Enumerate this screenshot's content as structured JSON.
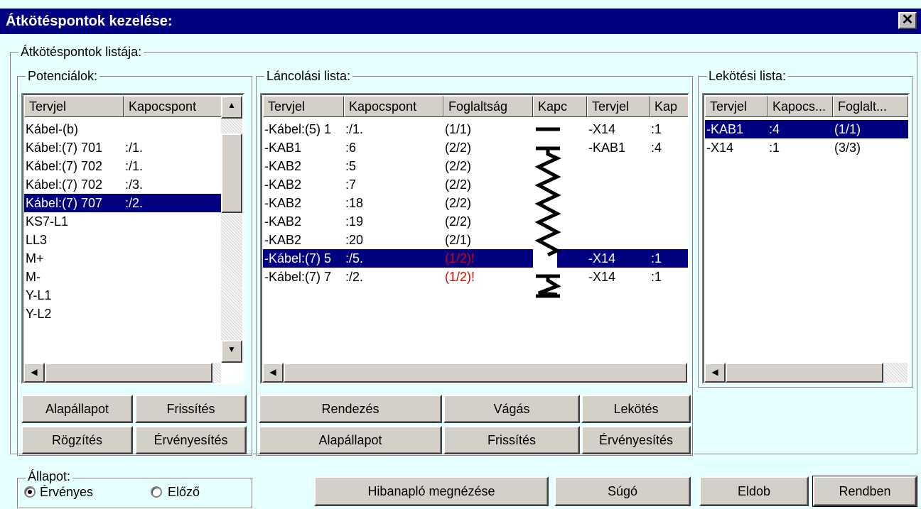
{
  "window": {
    "title": "Átkötéspontok kezelése:",
    "close": "✕"
  },
  "outer_group": "Átkötéspontok listája:",
  "potentials": {
    "label": "Potenciálok:",
    "columns": [
      "Tervjel",
      "Kapocspont"
    ],
    "rows": [
      {
        "a": "Kábel-(b)",
        "b": ""
      },
      {
        "a": "Kábel:(7) 701",
        "b": ":/1."
      },
      {
        "a": "Kábel:(7) 702",
        "b": ":/1."
      },
      {
        "a": "Kábel:(7) 702",
        "b": ":/3."
      },
      {
        "a": "Kábel:(7) 707",
        "b": ":/2."
      },
      {
        "a": "KS7-L1",
        "b": ""
      },
      {
        "a": "LL3",
        "b": ""
      },
      {
        "a": "M+",
        "b": ""
      },
      {
        "a": "M-",
        "b": ""
      },
      {
        "a": "Y-L1",
        "b": ""
      },
      {
        "a": "Y-L2",
        "b": ""
      }
    ],
    "selected_index": 4,
    "buttons": [
      "Alapállapot",
      "Frissítés",
      "Rögzítés",
      "Érvényesítés"
    ]
  },
  "chain": {
    "label": "Láncolási lista:",
    "columns": [
      "Tervjel",
      "Kapocspont",
      "Foglaltság",
      "Kapc",
      "Tervjel",
      "Kap"
    ],
    "rows": [
      {
        "t": "-Kábel:(5) 1",
        "k": ":/1.",
        "f": "(1/1)",
        "t2": "-X14",
        "k2": ":1"
      },
      {
        "t": "-KAB1",
        "k": ":6",
        "f": "(2/2)",
        "t2": "-KAB1",
        "k2": ":4"
      },
      {
        "t": "-KAB2",
        "k": ":5",
        "f": "(2/2)",
        "t2": "",
        "k2": ""
      },
      {
        "t": "-KAB2",
        "k": ":7",
        "f": "(2/2)",
        "t2": "",
        "k2": ""
      },
      {
        "t": "-KAB2",
        "k": ":18",
        "f": "(2/2)",
        "t2": "",
        "k2": ""
      },
      {
        "t": "-KAB2",
        "k": ":19",
        "f": "(2/2)",
        "t2": "",
        "k2": ""
      },
      {
        "t": "-KAB2",
        "k": ":20",
        "f": "(2/1)",
        "t2": "",
        "k2": ""
      },
      {
        "t": "-Kábel:(7) 5",
        "k": ":/5.",
        "f": "(1/2)!",
        "t2": "-X14",
        "k2": ":1"
      },
      {
        "t": "-Kábel:(7) 7",
        "k": ":/2.",
        "f": "(1/2)!",
        "t2": "-X14",
        "k2": ":1"
      }
    ],
    "selected_index": 7,
    "error_rows": [
      7,
      8
    ],
    "buttons": [
      "Rendezés",
      "Vágás",
      "Lekötés",
      "Alapállapot",
      "Frissítés",
      "Érvényesítés"
    ]
  },
  "lekotes": {
    "label": "Lekötési lista:",
    "columns": [
      "Tervjel",
      "Kapocs...",
      "Foglalt..."
    ],
    "rows": [
      {
        "t": "-KAB1",
        "k": ":4",
        "f": "(1/1)"
      },
      {
        "t": "-X14",
        "k": ":1",
        "f": "(3/3)"
      }
    ],
    "selected_index": 0
  },
  "state": {
    "label": "Állapot:",
    "options": [
      "Érvényes",
      "Előző"
    ],
    "selected": "Érvényes"
  },
  "footer_buttons": {
    "log": "Hibanapló megnézése",
    "help": "Súgó",
    "discard": "Eldob",
    "ok": "Rendben"
  },
  "colors": {
    "selection": "#000080",
    "error_text": "#e00000",
    "background": "#e6ffff",
    "button_face": "#d4d0c8"
  }
}
